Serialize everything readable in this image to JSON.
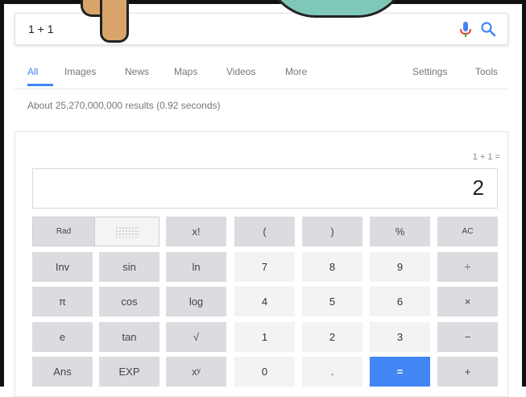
{
  "search": {
    "query": "1 + 1"
  },
  "tabs": [
    {
      "label": "All",
      "active": true
    },
    {
      "label": "Images",
      "active": false
    },
    {
      "label": "News",
      "active": false
    },
    {
      "label": "Maps",
      "active": false
    },
    {
      "label": "Videos",
      "active": false
    },
    {
      "label": "More",
      "active": false
    },
    {
      "label": "Settings",
      "active": false
    },
    {
      "label": "Tools",
      "active": false
    }
  ],
  "result_stats": "About 25,270,000,000 results (0.92 seconds)",
  "calculator": {
    "expression": "1 + 1 =",
    "result": "2",
    "keys": {
      "rad": "Rad",
      "factorial": "x!",
      "open_paren": "(",
      "close_paren": ")",
      "percent": "%",
      "clear": "AC",
      "inv": "Inv",
      "sin": "sin",
      "ln": "ln",
      "seven": "7",
      "eight": "8",
      "nine": "9",
      "divide": "÷",
      "pi": "π",
      "cos": "cos",
      "log": "log",
      "four": "4",
      "five": "5",
      "six": "6",
      "multiply": "×",
      "e": "e",
      "tan": "tan",
      "sqrt": "√",
      "one": "1",
      "two": "2",
      "three": "3",
      "minus": "−",
      "ans": "Ans",
      "exp": "EXP",
      "power": "xʸ",
      "zero": "0",
      "dot": ".",
      "equals": "=",
      "plus": "+"
    }
  },
  "colors": {
    "accent": "#4285f4",
    "key_function": "#dadce0",
    "key_number": "#f1f3f4",
    "text_muted": "#777777"
  },
  "icons": {
    "mic": "mic-icon",
    "search": "search-icon"
  }
}
